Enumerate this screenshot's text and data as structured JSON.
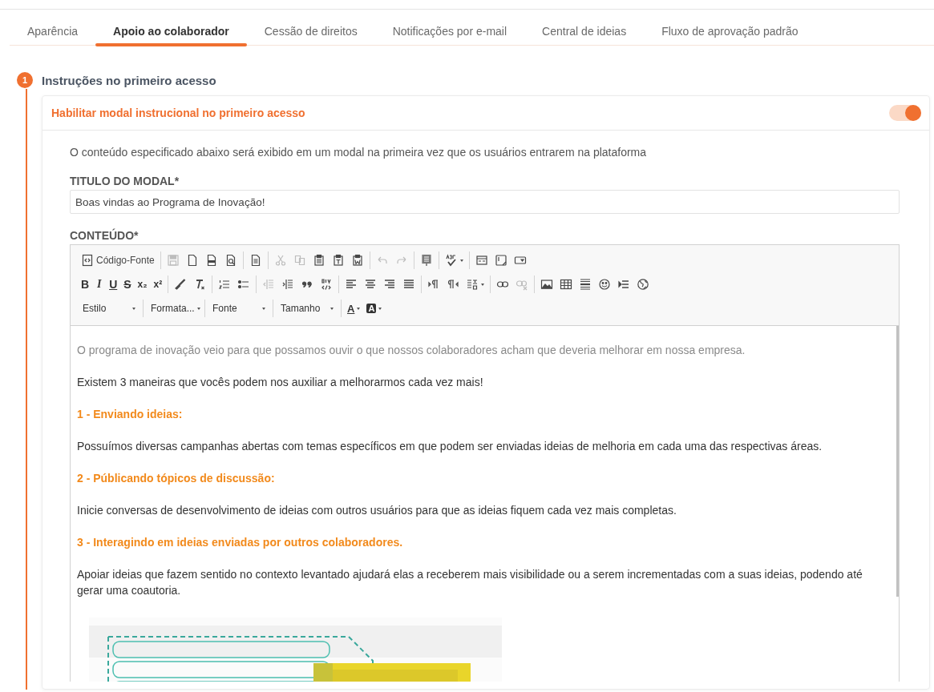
{
  "tabs": [
    {
      "label": "Aparência",
      "selected": false
    },
    {
      "label": "Apoio ao colaborador",
      "selected": true
    },
    {
      "label": "Cessão de direitos",
      "selected": false
    },
    {
      "label": "Notificações por e-mail",
      "selected": false
    },
    {
      "label": "Central de ideias",
      "selected": false
    },
    {
      "label": "Fluxo de aprovação padrão",
      "selected": false
    }
  ],
  "step": {
    "number": "1",
    "title": "Instruções no primeiro acesso"
  },
  "card": {
    "title": "Habilitar modal instrucional no primeiro acesso",
    "toggle": {
      "on": true
    },
    "description": "O conteúdo especificado abaixo será exibido em um modal na primeira vez que os usuários entrarem na plataforma",
    "title_field": {
      "label": "TITULO DO MODAL*",
      "value": "Boas vindas ao Programa de Inovação!"
    },
    "content_label": "CONTEÚDO*"
  },
  "toolbar": {
    "rows": [
      [
        [
          {
            "kind": "source",
            "label": "Código-Fonte"
          }
        ],
        [
          {
            "kind": "icon",
            "disabled": true
          },
          {
            "kind": "icon",
            "disabled": false
          },
          {
            "kind": "icon",
            "disabled": false
          },
          {
            "kind": "icon",
            "disabled": false
          }
        ],
        [
          {
            "kind": "icon",
            "disabled": false
          }
        ],
        [
          {
            "kind": "icon",
            "disabled": true
          },
          {
            "kind": "icon",
            "disabled": true
          },
          {
            "kind": "icon",
            "disabled": false
          },
          {
            "kind": "icon",
            "disabled": false
          },
          {
            "kind": "icon",
            "disabled": false
          }
        ],
        [
          {
            "kind": "icon",
            "disabled": true
          },
          {
            "kind": "icon",
            "disabled": true
          }
        ],
        [
          {
            "kind": "icon",
            "disabled": false
          }
        ],
        [
          {
            "kind": "icon",
            "disabled": false,
            "dropdown": true
          }
        ],
        [
          {
            "kind": "icon",
            "disabled": false
          },
          {
            "kind": "icon",
            "disabled": false
          },
          {
            "kind": "icon",
            "disabled": false
          }
        ]
      ],
      [
        [
          {
            "kind": "text",
            "label": "B"
          },
          {
            "kind": "text",
            "label": "I"
          },
          {
            "kind": "text",
            "label": "U"
          },
          {
            "kind": "text",
            "label": "S"
          },
          {
            "kind": "text",
            "label": "x₂"
          },
          {
            "kind": "text",
            "label": "x²"
          }
        ],
        [
          {
            "kind": "icon",
            "disabled": false
          },
          {
            "kind": "icon",
            "disabled": false
          }
        ],
        [
          {
            "kind": "icon",
            "disabled": false
          },
          {
            "kind": "icon",
            "disabled": false
          }
        ],
        [
          {
            "kind": "icon",
            "disabled": true
          },
          {
            "kind": "icon",
            "disabled": false
          },
          {
            "kind": "icon",
            "disabled": false
          },
          {
            "kind": "icon",
            "disabled": false
          }
        ],
        [
          {
            "kind": "icon",
            "disabled": false
          },
          {
            "kind": "icon",
            "disabled": false
          },
          {
            "kind": "icon",
            "disabled": false
          },
          {
            "kind": "icon",
            "disabled": false
          }
        ],
        [
          {
            "kind": "icon",
            "disabled": false
          },
          {
            "kind": "icon",
            "disabled": false
          },
          {
            "kind": "icon",
            "disabled": false,
            "dropdown": true
          }
        ],
        [
          {
            "kind": "icon",
            "disabled": false
          },
          {
            "kind": "icon",
            "disabled": true
          }
        ],
        [
          {
            "kind": "icon",
            "disabled": false
          },
          {
            "kind": "icon",
            "disabled": false
          },
          {
            "kind": "icon",
            "disabled": false
          },
          {
            "kind": "icon",
            "disabled": false
          },
          {
            "kind": "icon",
            "disabled": false
          },
          {
            "kind": "icon",
            "disabled": false
          }
        ]
      ],
      [
        [
          {
            "kind": "combo",
            "label": "Estilo"
          }
        ],
        [
          {
            "kind": "combo",
            "label": "Formata..."
          }
        ],
        [
          {
            "kind": "combo",
            "label": "Fonte"
          }
        ],
        [
          {
            "kind": "combo",
            "label": "Tamanho"
          }
        ],
        [
          {
            "kind": "color",
            "label": "A"
          },
          {
            "kind": "bgcolor",
            "label": "A"
          }
        ]
      ]
    ]
  },
  "content": [
    {
      "kind": "intro",
      "text": "O programa de inovação veio para que possamos ouvir o que nossos colaboradores acham que deveria melhorar em nossa empresa."
    },
    {
      "kind": "paragraph",
      "text": "Existem 3 maneiras que vocês podem nos auxiliar a melhorarmos cada vez mais!"
    },
    {
      "kind": "heading",
      "text": "1 - Enviando ideias:"
    },
    {
      "kind": "paragraph",
      "text": "Possuímos diversas campanhas abertas com temas específicos em que podem ser enviadas ideias de melhoria em cada uma das respectivas áreas."
    },
    {
      "kind": "heading",
      "text": "2 - Públicando tópicos de discussão:"
    },
    {
      "kind": "paragraph",
      "text": "Inicie conversas de desenvolvimento de ideias com outros usuários para que as ideias fiquem cada vez mais completas."
    },
    {
      "kind": "heading",
      "text": "3 - Interagindo em ideias enviadas por outros colaboradores."
    },
    {
      "kind": "paragraph",
      "text": "Apoiar ideias que fazem sentido no contexto levantado ajudará elas a receberem mais visibilidade ou a serem incrementadas com a suas ideias, podendo até gerar uma coautoria."
    },
    {
      "kind": "picture"
    }
  ]
}
